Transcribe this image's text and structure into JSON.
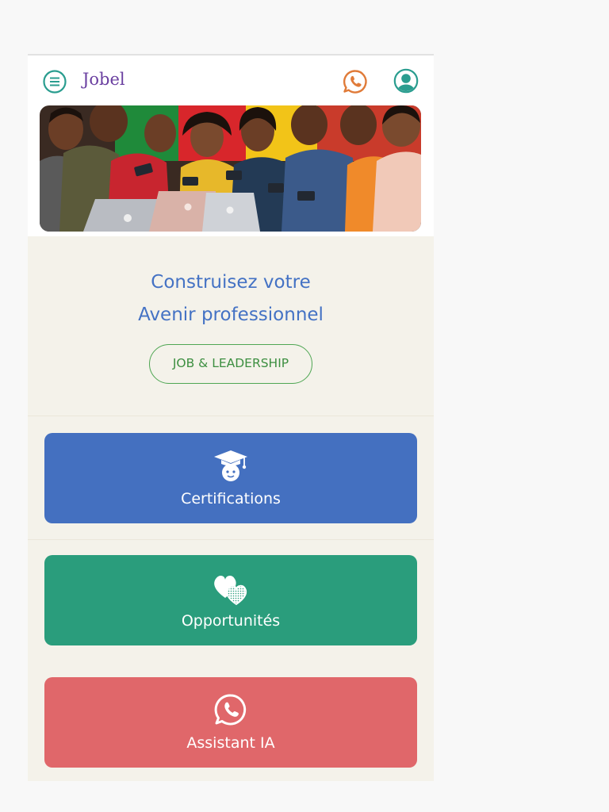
{
  "header": {
    "brand": "Jobel",
    "icons": [
      "menu-icon",
      "whatsapp-icon",
      "user-icon"
    ],
    "menu_color": "#2a9d8f",
    "whatsapp_color": "#e07b39",
    "user_color": "#2a9d8f"
  },
  "hero": {
    "image": "group-of-young-people-with-phones-and-laptops"
  },
  "headline": {
    "line1": "Construisez votre",
    "line2": "Avenir professionnel"
  },
  "tag_button": {
    "label": "JOB & LEADERSHIP"
  },
  "cards": [
    {
      "label": "Certifications",
      "icon": "graduation-icon",
      "color": "#4470c0"
    },
    {
      "label": "Opportunités",
      "icon": "hearts-icon",
      "color": "#2a9d7c"
    },
    {
      "label": "Assistant IA",
      "icon": "whatsapp-icon",
      "color": "#e0676a"
    }
  ]
}
